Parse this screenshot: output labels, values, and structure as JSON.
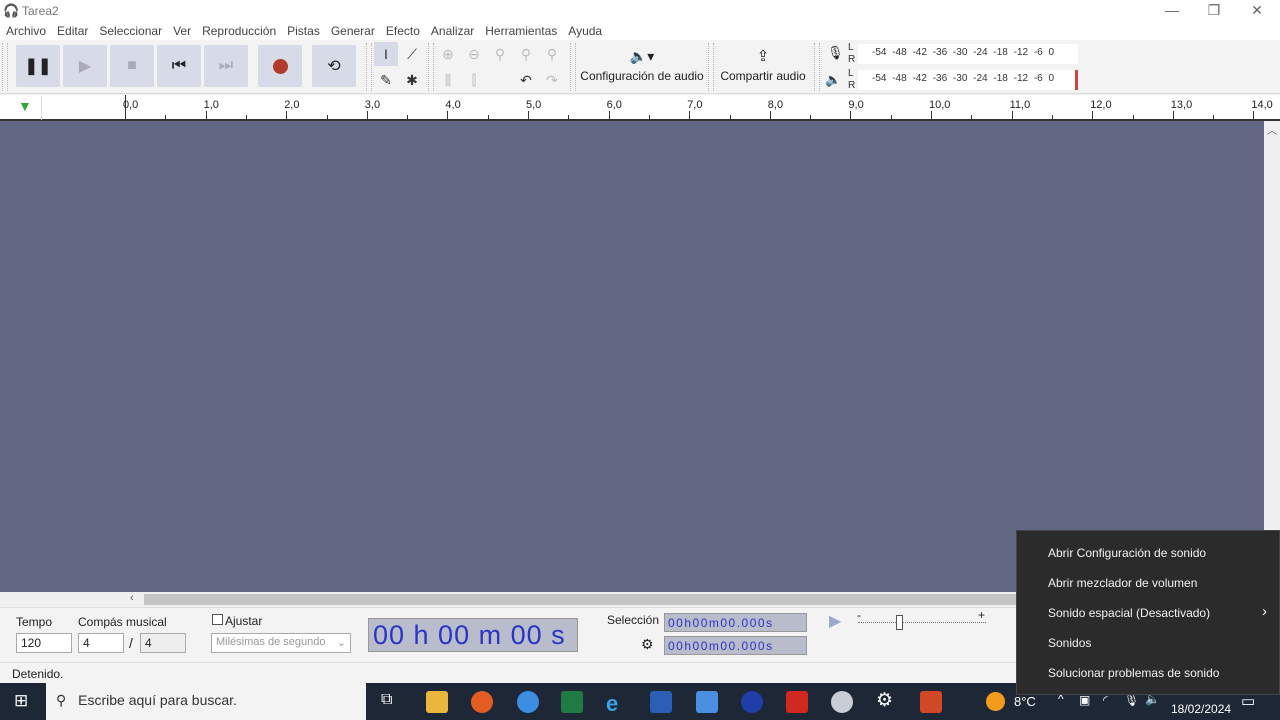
{
  "window": {
    "title": "Tarea2",
    "minimize": "—",
    "restore": "❐",
    "close": "✕"
  },
  "menu": [
    "Archivo",
    "Editar",
    "Seleccionar",
    "Ver",
    "Reproducción",
    "Pistas",
    "Generar",
    "Efecto",
    "Analizar",
    "Herramientas",
    "Ayuda"
  ],
  "toolbar": {
    "audio_setup_label": "Configuración de audio",
    "share_audio_label": "Compartir audio",
    "meter_scale_rec": "-54 -48 -42 -36 -30 -24 -18 -12 -6 0",
    "meter_scale_play": "-54 -48 -42 -36 -30 -24 -18 -12 -6 0",
    "channel_l": "L",
    "channel_r": "R"
  },
  "ruler": {
    "labels": [
      "0,0",
      "1,0",
      "2,0",
      "3,0",
      "4,0",
      "5,0",
      "6,0",
      "7,0",
      "8,0",
      "9,0",
      "10,0",
      "11,0",
      "12,0",
      "13,0",
      "14,0"
    ]
  },
  "bottom": {
    "tempo_label": "Tempo",
    "tempo_value": "120",
    "time_sig_label": "Compás musical",
    "time_sig_num": "4",
    "time_sig_sep": "/",
    "time_sig_den": "4",
    "snap_label": "Ajustar",
    "snap_checked": false,
    "snap_unit": "Milésimas de segundo",
    "time_display": "00 h 00 m 00 s",
    "selection_label": "Selección",
    "selection_start": "00h00m00.000s",
    "selection_end": "00h00m00.000s",
    "speed_min": "-",
    "speed_max": "+"
  },
  "status": "Detenido.",
  "taskbar": {
    "search_placeholder": "Escribe aquí para buscar.",
    "weather": "8°C",
    "date": "18/02/2024"
  },
  "context_menu": {
    "items": [
      "Abrir Configuración de sonido",
      "Abrir mezclador de volumen",
      "Sonido espacial (Desactivado)",
      "Sonidos",
      "Solucionar problemas de sonido"
    ]
  },
  "colors": {
    "track_bg": "#626884",
    "record": "#b23a2a",
    "time_text": "#2a34c8",
    "taskbar": "#1d2735",
    "menu_bg": "#2b2b2b"
  }
}
